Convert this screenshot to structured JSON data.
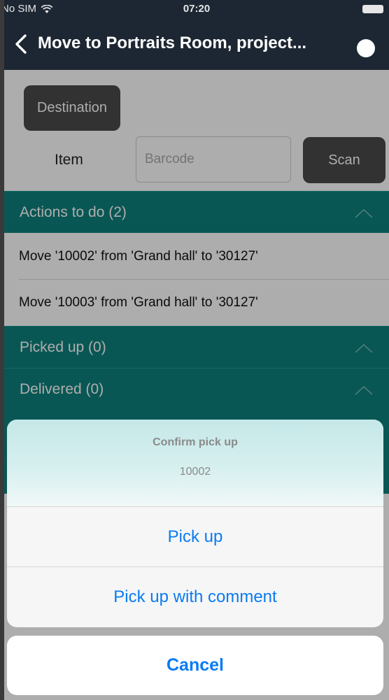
{
  "status": {
    "carrier": "No SIM",
    "time": "07:20",
    "wifi_icon": "wifi-icon",
    "battery_icon": "battery-icon"
  },
  "nav": {
    "back_icon": "chevron-left-icon",
    "title": "Move to Portraits Room, project..."
  },
  "form": {
    "destination_label": "Destination",
    "item_label": "Item",
    "barcode_placeholder": "Barcode",
    "scan_label": "Scan"
  },
  "sections": [
    {
      "label": "Actions to do (2)",
      "items": [
        "Move '10002' from 'Grand hall' to '30127'",
        "Move '10003' from 'Grand hall' to '30127'"
      ]
    },
    {
      "label": "Picked up (0)",
      "items": []
    },
    {
      "label": "Delivered (0)",
      "items": []
    }
  ],
  "sheet": {
    "title": "Confirm pick up",
    "message": "10002",
    "actions": [
      "Pick up",
      "Pick up with comment"
    ],
    "cancel_label": "Cancel"
  },
  "colors": {
    "nav_bg": "#1d2733",
    "accent_teal": "#0e807c",
    "ios_blue": "#0a7bf2",
    "button_dark": "#4a4a4a"
  }
}
